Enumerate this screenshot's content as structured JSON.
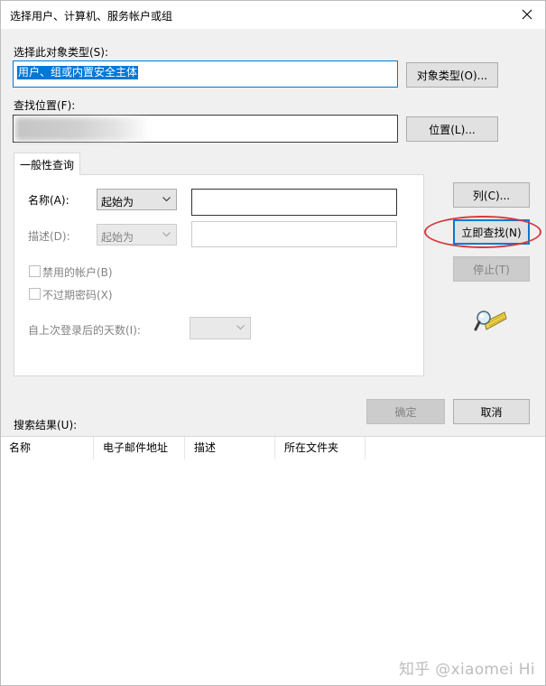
{
  "window": {
    "title": "选择用户、计算机、服务帐户或组"
  },
  "object_type": {
    "label": "选择此对象类型(S):",
    "value": "用户、组或内置安全主体",
    "button": "对象类型(O)..."
  },
  "location": {
    "label": "查找位置(F):",
    "button": "位置(L)..."
  },
  "common_query": {
    "tab_label": "一般性查询",
    "name": {
      "label": "名称(A):",
      "mode": "起始为",
      "value": ""
    },
    "description": {
      "label": "描述(D):",
      "mode": "起始为",
      "value": ""
    },
    "disabled_accounts": {
      "label": "禁用的帐户(B)",
      "checked": false
    },
    "non_expiring_passwords": {
      "label": "不过期密码(X)",
      "checked": false
    },
    "days_since_last_logon": {
      "label": "自上次登录后的天数(I):",
      "value": ""
    }
  },
  "side_buttons": {
    "columns": "列(C)...",
    "find_now": "立即查找(N)",
    "stop": "停止(T)"
  },
  "footer": {
    "ok": "确定",
    "cancel": "取消"
  },
  "results": {
    "label": "搜索结果(U):",
    "columns": [
      "名称",
      "电子邮件地址",
      "描述",
      "所在文件夹"
    ]
  },
  "watermark": {
    "text": "知乎 @xiaomei Hi"
  },
  "icons": {
    "close": "close-icon",
    "search_flashlight": "search-flashlight-icon",
    "dropdown": "chevron-down-icon"
  },
  "colors": {
    "selection": "#0078d7",
    "annotation_circle": "#d63a3f",
    "dialog_bg": "#f0f0f0"
  }
}
